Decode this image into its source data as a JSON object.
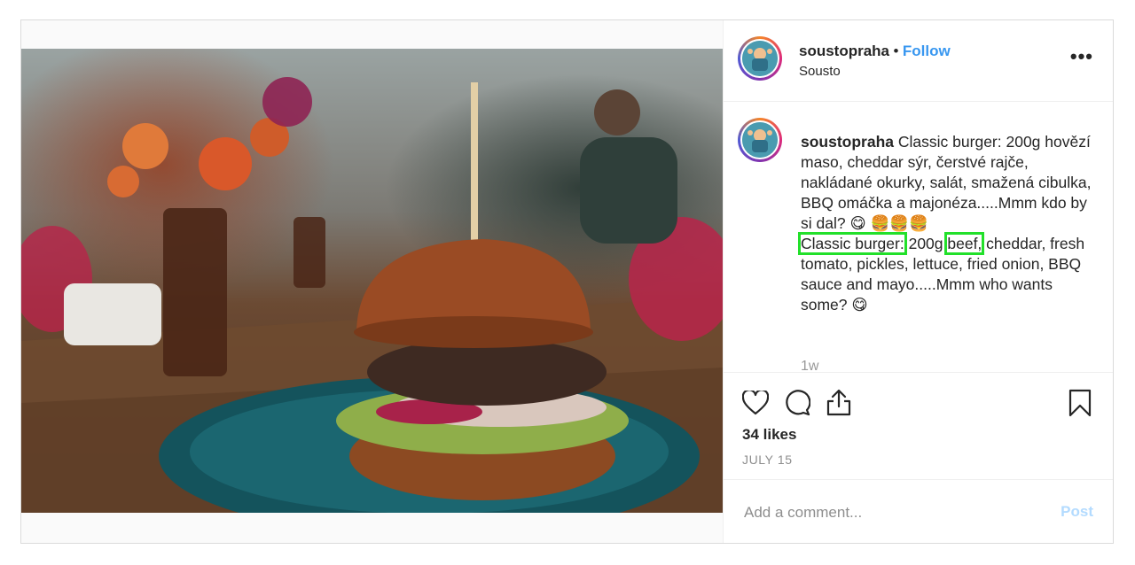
{
  "post": {
    "username": "soustopraha",
    "separator": "•",
    "follow_label": "Follow",
    "location": "Sousto",
    "more_label": "•••",
    "caption": {
      "username": "soustopraha",
      "czech_text": "Classic burger: 200g hovězí maso, cheddar sýr, čerstvé rajče, nakládané okurky, salát, smažená cibulka, BBQ omáčka a majonéza.....Mmm kdo by si dal?",
      "emoji_smile": "😋",
      "emoji_burgers": "🍔🍔🍔",
      "en_highlight_1": "Classic burger:",
      "en_mid": " 200g ",
      "en_highlight_2": "beef,",
      "en_rest": " cheddar, fresh tomato, pickles, lettuce, fried onion, BBQ sauce and mayo.....Mmm who wants some?",
      "emoji_smile_2": "😋"
    },
    "time_ago": "1w",
    "likes": "34 likes",
    "date": "JULY 15",
    "comment_placeholder": "Add a comment...",
    "post_label": "Post",
    "icons": [
      "heart-icon",
      "comment-icon",
      "share-icon",
      "bookmark-icon"
    ],
    "colors": {
      "highlight_box": "#22e02a",
      "follow": "#3897f0",
      "post_disabled": "#b3dbff"
    }
  }
}
